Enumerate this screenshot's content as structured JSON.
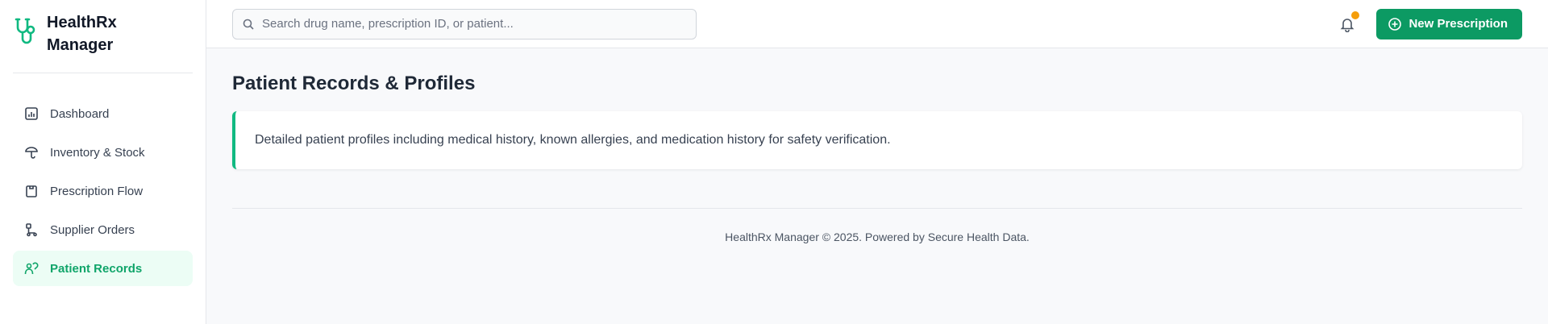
{
  "brand": {
    "name_line1": "HealthRx",
    "name_line2": "Manager",
    "logo_icon": "stethoscope-logo-icon",
    "accent": "#10b981"
  },
  "sidebar": {
    "items": [
      {
        "label": "Dashboard",
        "icon": "chart-icon",
        "active": false
      },
      {
        "label": "Inventory & Stock",
        "icon": "pill-icon",
        "active": false
      },
      {
        "label": "Prescription Flow",
        "icon": "clipboard-icon",
        "active": false
      },
      {
        "label": "Supplier Orders",
        "icon": "truck-icon",
        "active": false
      },
      {
        "label": "Patient Records",
        "icon": "patient-icon",
        "active": true
      }
    ]
  },
  "header": {
    "search_placeholder": "Search drug name, prescription ID, or patient...",
    "search_value": "",
    "notification_dot_color": "#f59e0b",
    "new_prescription_label": "New Prescription",
    "button_color": "#0c9a63"
  },
  "main": {
    "title": "Patient Records & Profiles",
    "description": "Detailed patient profiles including medical history, known allergies, and medication history for safety verification."
  },
  "footer": {
    "text": "HealthRx Manager © 2025. Powered by Secure Health Data."
  }
}
